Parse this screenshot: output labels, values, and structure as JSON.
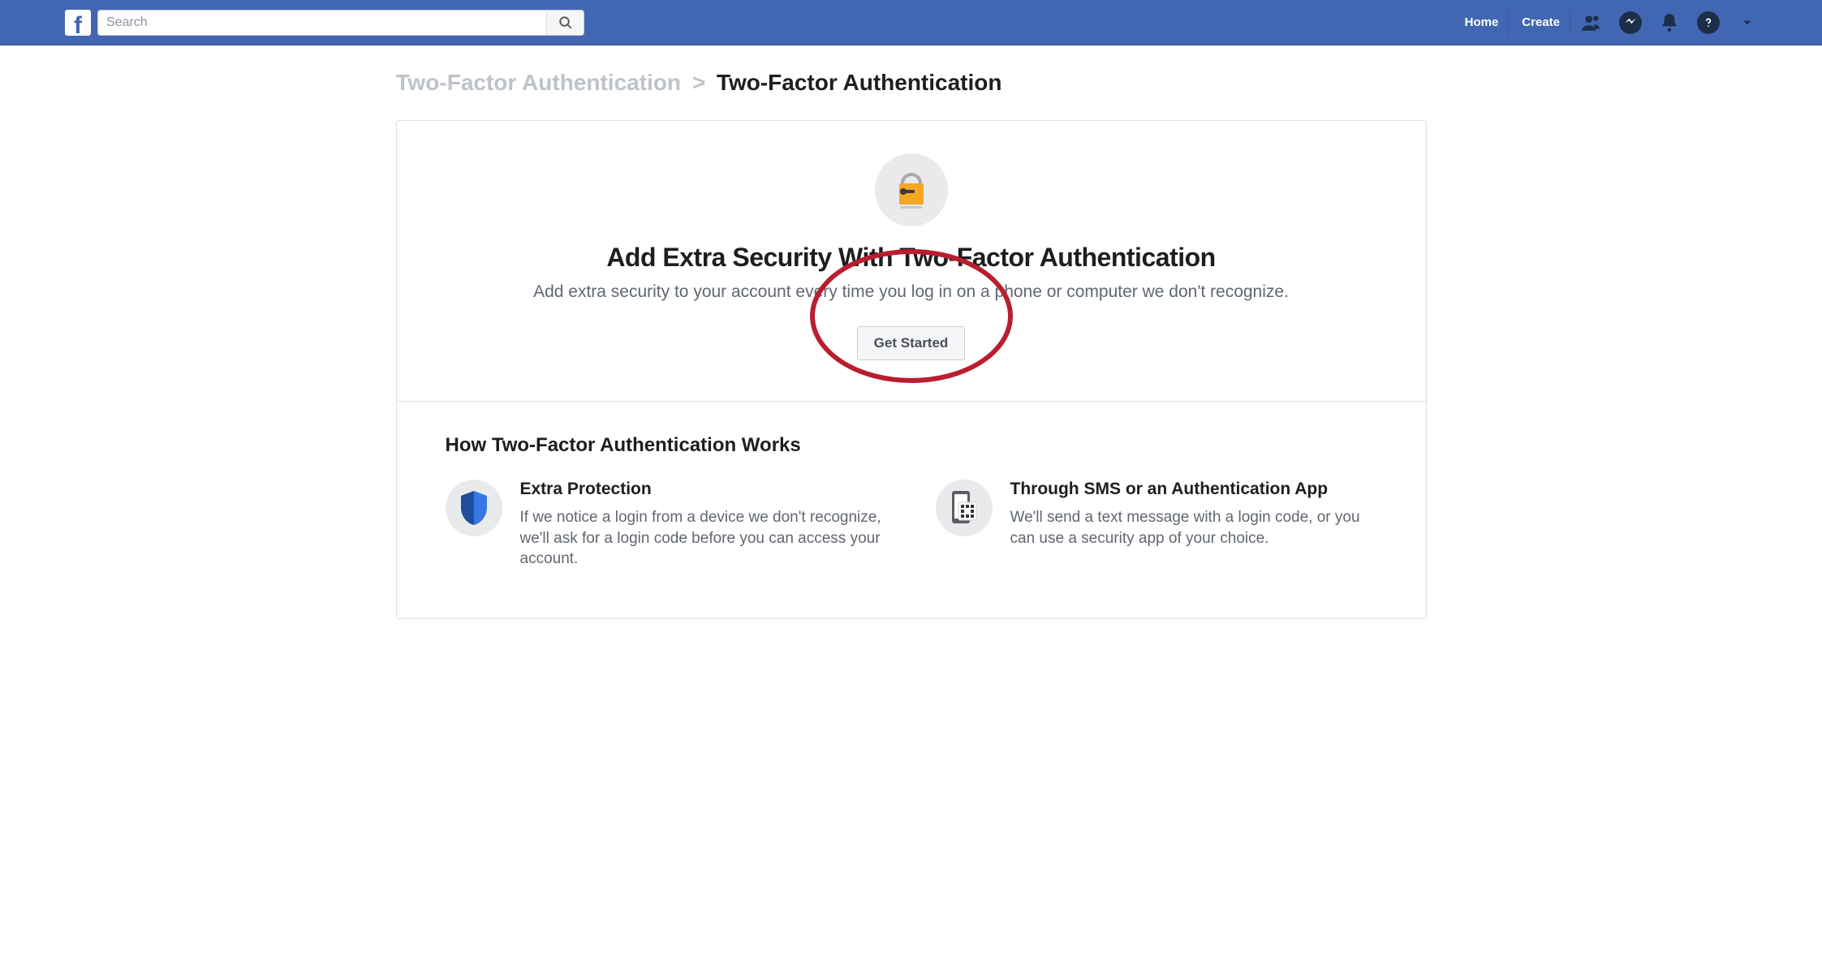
{
  "header": {
    "search_placeholder": "Search",
    "nav": {
      "home": "Home",
      "create": "Create"
    }
  },
  "breadcrumb": {
    "parent": "Two-Factor Authentication",
    "separator": ">",
    "current": "Two-Factor Authentication"
  },
  "hero": {
    "title": "Add Extra Security With Two-Factor Authentication",
    "subtitle": "Add extra security to your account every time you log in on a phone or computer we don't recognize.",
    "cta": "Get Started"
  },
  "how": {
    "heading": "How Two-Factor Authentication Works",
    "cards": [
      {
        "title": "Extra Protection",
        "text": "If we notice a login from a device we don't recognize, we'll ask for a login code before you can access your account."
      },
      {
        "title": "Through SMS or an Authentication App",
        "text": "We'll send a text message with a login code, or you can use a security app of your choice."
      }
    ]
  }
}
